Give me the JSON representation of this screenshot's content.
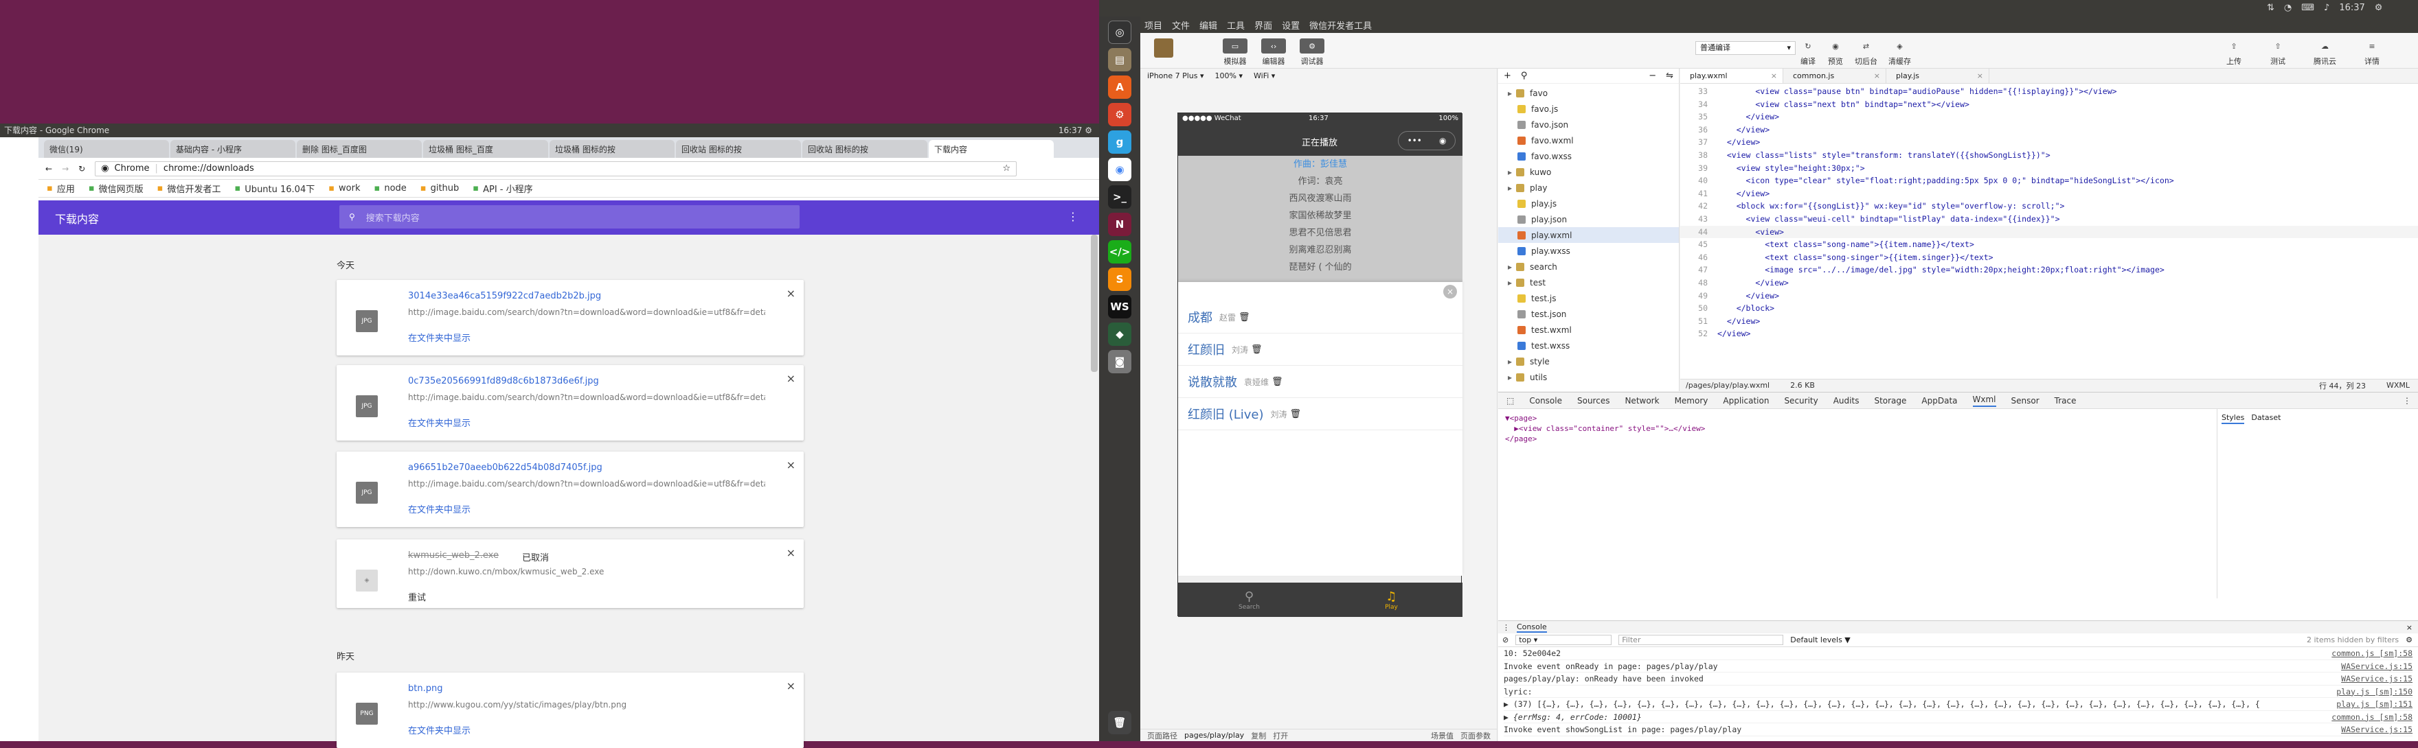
{
  "system": {
    "time": "16:37",
    "right_time": "16:37"
  },
  "chrome": {
    "title": "下载内容 - Google Chrome",
    "tabs": [
      "微信(19)",
      "基础内容 - 小程序",
      "删除 图标_百度图",
      "垃圾桶 图标_百度",
      "垃圾桶 图标的按",
      "回收站 图标的按",
      "回收站 图标的按",
      "下载内容"
    ],
    "url_label": "Chrome",
    "url": "chrome://downloads",
    "bookmarks": [
      "应用",
      "微信网页版",
      "微信开发者工",
      "Ubuntu 16.04下",
      "work",
      "node",
      "github",
      "API - 小程序"
    ],
    "page_title": "下载内容",
    "search_placeholder": "搜索下载内容",
    "date_today": "今天",
    "date_yesterday": "昨天",
    "downloads": [
      {
        "name": "3014e33ea46ca5159f922cd7aedb2b2b.jpg",
        "url": "http://image.baidu.com/search/down?tn=download&word=download&ie=utf8&fr=detail&...",
        "action": "在文件夹中显示",
        "type": "JPG"
      },
      {
        "name": "0c735e20566991fd89d8c6b1873d6e6f.jpg",
        "url": "http://image.baidu.com/search/down?tn=download&word=download&ie=utf8&fr=detail&...",
        "action": "在文件夹中显示",
        "type": "JPG"
      },
      {
        "name": "a96651b2e70aeeb0b622d54b08d7405f.jpg",
        "url": "http://image.baidu.com/search/down?tn=download&word=download&ie=utf8&fr=detail&...",
        "action": "在文件夹中显示",
        "type": "JPG"
      },
      {
        "name": "kwmusic_web_2.exe",
        "status": "已取消",
        "url": "http://down.kuwo.cn/mbox/kwmusic_web_2.exe",
        "action": "重试"
      },
      {
        "name": "btn.png",
        "url": "http://www.kugou.com/yy/static/images/play/btn.png",
        "action": "在文件夹中显示",
        "type": "PNG"
      }
    ]
  },
  "devtool": {
    "menu": [
      "项目",
      "文件",
      "编辑",
      "工具",
      "界面",
      "设置",
      "微信开发者工具"
    ],
    "toolbar": [
      "模拟器",
      "编辑器",
      "调试器"
    ],
    "toolbar_right": [
      "编译",
      "预览",
      "切后台",
      "清缓存"
    ],
    "far_right": [
      "上传",
      "测试",
      "腾讯云",
      "详情"
    ],
    "compile_mode": "普通编译",
    "device": "iPhone 7 Plus",
    "zoom": "100%",
    "network": "WiFi",
    "phone": {
      "carrier": "●●●●● WeChat",
      "time": "16:37",
      "battery": "100%",
      "nav_title": "正在播放",
      "lyrics": [
        "作曲：彭佳慧",
        "作词：袁亮",
        "西风夜渡寒山雨",
        "家国依稀故梦里",
        "思君不见倍思君",
        "别离难忍忍别离",
        "琵琶好 ( 个仙的"
      ],
      "songs": [
        {
          "name": "成都",
          "artist": "赵雷"
        },
        {
          "name": "红颜旧",
          "artist": "刘涛"
        },
        {
          "name": "说散就散",
          "artist": "袁娅维"
        },
        {
          "name": "红颜旧 (Live)",
          "artist": "刘涛"
        }
      ],
      "tab_search": "Search",
      "tab_play": "Play"
    },
    "status_bar": {
      "path_label": "页面路径",
      "path": "pages/play/play",
      "copy": "复制",
      "open": "打开",
      "scene": "场景值",
      "params": "页面参数"
    },
    "tree": [
      {
        "n": "favo",
        "d": 1,
        "t": "dir"
      },
      {
        "n": "favo.js",
        "d": 2,
        "t": "js"
      },
      {
        "n": "favo.json",
        "d": 2,
        "t": "json"
      },
      {
        "n": "favo.wxml",
        "d": 2,
        "t": "wxml"
      },
      {
        "n": "favo.wxss",
        "d": 2,
        "t": "wxss"
      },
      {
        "n": "kuwo",
        "d": 1,
        "t": "dir"
      },
      {
        "n": "play",
        "d": 1,
        "t": "dir"
      },
      {
        "n": "play.js",
        "d": 2,
        "t": "js"
      },
      {
        "n": "play.json",
        "d": 2,
        "t": "json"
      },
      {
        "n": "play.wxml",
        "d": 2,
        "t": "wxml"
      },
      {
        "n": "play.wxss",
        "d": 2,
        "t": "wxss"
      },
      {
        "n": "search",
        "d": 1,
        "t": "dir"
      },
      {
        "n": "test",
        "d": 1,
        "t": "dir"
      },
      {
        "n": "test.js",
        "d": 2,
        "t": "js"
      },
      {
        "n": "test.json",
        "d": 2,
        "t": "json"
      },
      {
        "n": "test.wxml",
        "d": 2,
        "t": "wxml"
      },
      {
        "n": "test.wxss",
        "d": 2,
        "t": "wxss"
      },
      {
        "n": "style",
        "d": 1,
        "t": "dir"
      },
      {
        "n": "utils",
        "d": 1,
        "t": "dir"
      }
    ],
    "editor_tabs": [
      "play.wxml",
      "common.js",
      "play.js"
    ],
    "code": [
      {
        "n": "33",
        "t": "        <view class=\"pause btn\" bindtap=\"audioPause\" hidden=\"{{!isplaying}}\"></view>"
      },
      {
        "n": "34",
        "t": "        <view class=\"next btn\" bindtap=\"next\"></view>"
      },
      {
        "n": "35",
        "t": "      </view>"
      },
      {
        "n": "36",
        "t": "    </view>"
      },
      {
        "n": "37",
        "t": "  </view>"
      },
      {
        "n": "38",
        "t": "  <view class=\"lists\" style=\"transform: translateY({{showSongList}})\">"
      },
      {
        "n": "39",
        "t": "    <view style=\"height:30px;\">"
      },
      {
        "n": "40",
        "t": "      <icon type=\"clear\" style=\"float:right;padding:5px 5px 0 0;\" bindtap=\"hideSongList\"></icon>"
      },
      {
        "n": "41",
        "t": "    </view>"
      },
      {
        "n": "42",
        "t": "    <block wx:for=\"{{songList}}\" wx:key=\"id\" style=\"overflow-y: scroll;\">"
      },
      {
        "n": "43",
        "t": "      <view class=\"weui-cell\" bindtap=\"listPlay\" data-index=\"{{index}}\">"
      },
      {
        "n": "44",
        "t": "        <view>"
      },
      {
        "n": "45",
        "t": "          <text class=\"song-name\">{{item.name}}</text>"
      },
      {
        "n": "46",
        "t": "          <text class=\"song-singer\">{{item.singer}}</text>"
      },
      {
        "n": "47",
        "t": "          <image src=\"../../image/del.jpg\" style=\"width:20px;height:20px;float:right\"></image>"
      },
      {
        "n": "48",
        "t": "        </view>"
      },
      {
        "n": "49",
        "t": "      </view>"
      },
      {
        "n": "50",
        "t": "    </block>"
      },
      {
        "n": "51",
        "t": "  </view>"
      },
      {
        "n": "52",
        "t": "</view>"
      }
    ],
    "file_path": "/pages/play/play.wxml",
    "file_size": "2.6 KB",
    "cursor": "行 44，列 23",
    "lang": "WXML",
    "dev_tabs": [
      "Console",
      "Sources",
      "Network",
      "Memory",
      "Application",
      "Security",
      "Audits",
      "Storage",
      "AppData",
      "Wxml",
      "Sensor",
      "Trace"
    ],
    "wxml_lines": [
      "▼<page>",
      "  ▶<view class=\"container\" style=\"\">…</view>",
      "</page>"
    ],
    "styles_tabs": [
      "Styles",
      "Dataset"
    ],
    "console_label": "Console",
    "console_top": "top",
    "console_filter": "Filter",
    "console_levels": "Default levels ▼",
    "console_hidden": "2 items hidden by filters",
    "console": [
      {
        "t": "10: 52e004e2",
        "s": "common.js [sm]:58"
      },
      {
        "t": "Invoke event onReady in page: pages/play/play",
        "s": "WAService.js:15"
      },
      {
        "t": "pages/play/play: onReady have been invoked",
        "s": "WAService.js:15"
      },
      {
        "t": "lyric:",
        "s": "play.js [sm]:150"
      },
      {
        "t": "▶ (37) [{…}, {…}, {…}, {…}, {…}, {…}, {…}, {…}, {…}, {…}, {…}, {…}, {…}, {…}, {…}, {…}, {…}, {…}, {…}, {…}, {…}, {…}, {…}, {…}, {…}, {…}, {…}, {…}, {…}, {…}, {…}, {…}, {…}, {…}, {…}]",
        "s": "play.js [sm]:151"
      },
      {
        "t": "▶ {errMsg: 4, errCode: 10001}",
        "s": "common.js [sm]:58"
      },
      {
        "t": "Invoke event showSongList in page: pages/play/play",
        "s": "WAService.js:15"
      }
    ]
  },
  "colors": {
    "desktop": "#6b1f4d",
    "launcher": "#3a3937",
    "chrome_header": "#5d3fd3",
    "link": "#3367d6"
  }
}
